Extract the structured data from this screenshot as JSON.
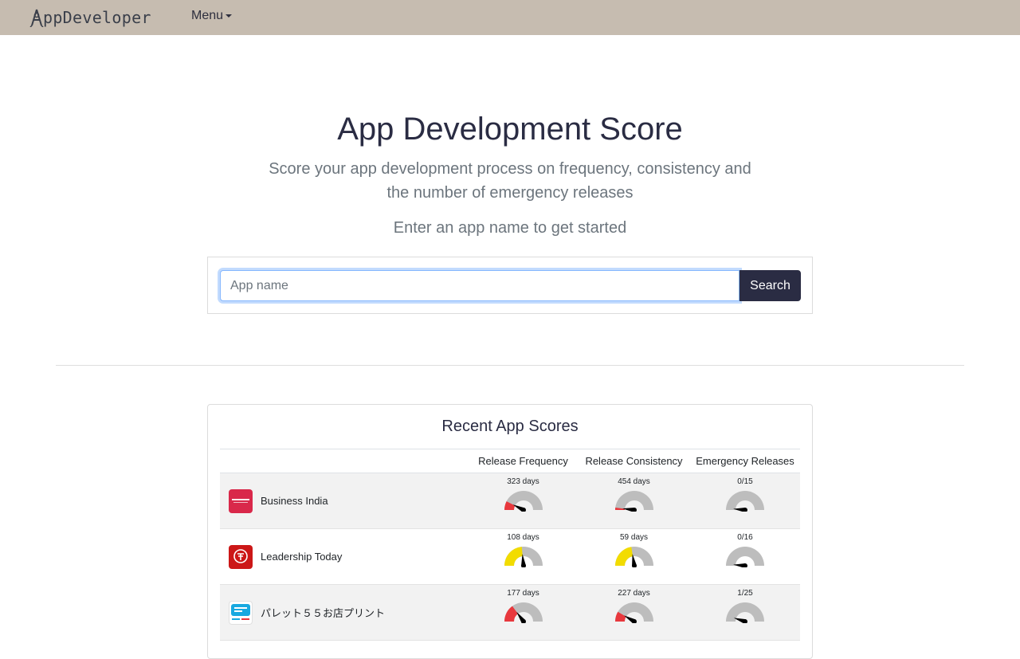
{
  "navbar": {
    "brand": "ppDeveloper",
    "menu_label": "Menu",
    "colors": {
      "background": "#c6bcb0",
      "brand_text": "#3a3f4a"
    }
  },
  "hero": {
    "title": "App Development Score",
    "subtitle": "Score your app development process on frequency, consistency and the number of emergency releases",
    "prompt": "Enter an app name to get started"
  },
  "search": {
    "placeholder": "App name",
    "value": "",
    "button_label": "Search",
    "colors": {
      "button": "#2a2c43",
      "focus_border": "#86b7fe"
    }
  },
  "recent": {
    "title": "Recent App Scores",
    "columns": [
      "",
      "Release Frequency",
      "Release Consistency",
      "Emergency Releases"
    ],
    "rows": [
      {
        "name": "Business India",
        "icon": "business-india-icon",
        "icon_color": "#d9284a",
        "frequency": {
          "label": "323 days",
          "level": 0.15,
          "zone": "red"
        },
        "consistency": {
          "label": "454 days",
          "level": 0.04,
          "zone": "red"
        },
        "emergency": {
          "label": "0/15",
          "level": 0.03,
          "zone": "none"
        }
      },
      {
        "name": "Leadership Today",
        "icon": "leadership-today-icon",
        "icon_color": "#cc1717",
        "frequency": {
          "label": "108 days",
          "level": 0.47,
          "zone": "yellow"
        },
        "consistency": {
          "label": "59 days",
          "level": 0.45,
          "zone": "yellow"
        },
        "emergency": {
          "label": "0/16",
          "level": 0.03,
          "zone": "none"
        }
      },
      {
        "name": "パレット５５お店プリント",
        "icon": "palette-55-icon",
        "icon_color": "#18a9e0",
        "frequency": {
          "label": "177 days",
          "level": 0.3,
          "zone": "red"
        },
        "consistency": {
          "label": "227 days",
          "level": 0.17,
          "zone": "red"
        },
        "emergency": {
          "label": "1/25",
          "level": 0.1,
          "zone": "none"
        }
      }
    ]
  },
  "gauge_colors": {
    "track": "#bdbdbd",
    "red": "#e8383d",
    "yellow": "#f2dc00",
    "needle": "#000000"
  }
}
